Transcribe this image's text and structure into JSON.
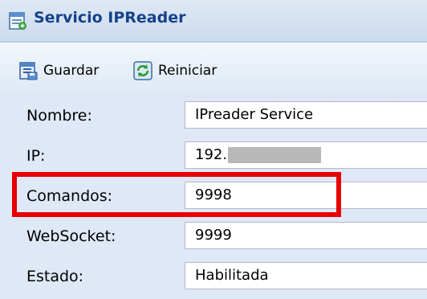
{
  "window": {
    "title": "Servicio IPReader",
    "icon": "service-window-icon"
  },
  "toolbar": {
    "save_label": "Guardar",
    "save_icon": "save-icon",
    "reset_label": "Reiniciar",
    "reset_icon": "refresh-icon"
  },
  "form": {
    "rows": [
      {
        "label": "Nombre:",
        "value": "IPreader Service"
      },
      {
        "label": "IP:",
        "value": "192.",
        "redacted": true
      },
      {
        "label": "Comandos:",
        "value": "9998",
        "highlighted": true
      },
      {
        "label": "WebSocket:",
        "value": "9999"
      },
      {
        "label": "Estado:",
        "value": "Habilitada"
      }
    ]
  },
  "colors": {
    "title_text": "#15428b",
    "panel_bg": "#dfe8f6",
    "highlight_border": "#e80000"
  }
}
